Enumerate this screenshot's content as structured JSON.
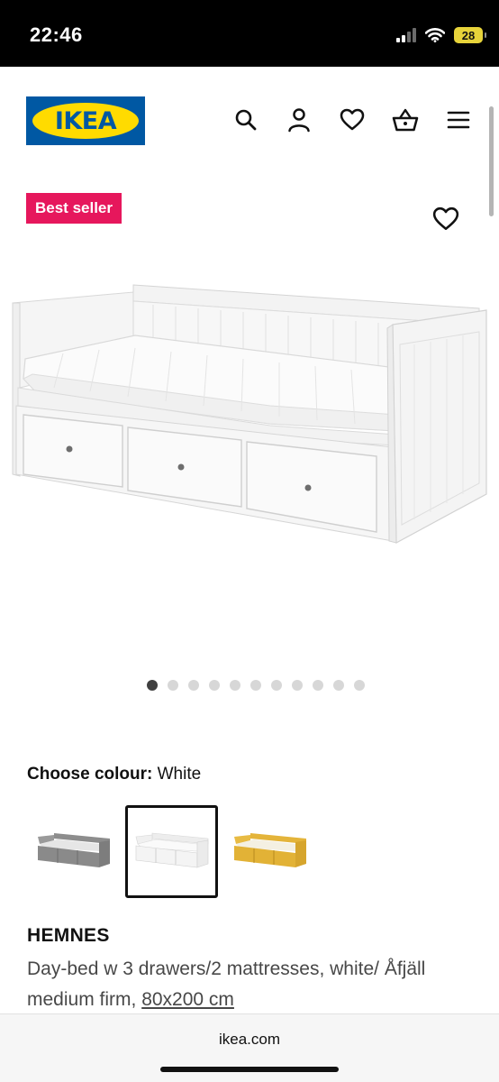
{
  "status_bar": {
    "time": "22:46",
    "battery": "28"
  },
  "header": {
    "logo_text": "IKEA"
  },
  "badge": {
    "label": "Best seller"
  },
  "carousel": {
    "total": 11,
    "active": 1
  },
  "colour": {
    "label": "Choose colour:",
    "value": "White",
    "swatch_colors": [
      "#8a8a8a",
      "#ffffff",
      "#e2b53a"
    ]
  },
  "product": {
    "name": "HEMNES",
    "description": "Day-bed w 3 drawers/2 mattresses, white/ Åfjäll medium firm,",
    "size": "80x200 cm"
  },
  "browser": {
    "url": "ikea.com"
  },
  "colors": {
    "ikea_blue": "#0058a3",
    "ikea_yellow": "#ffdb00",
    "badge_pink": "#e6175c"
  }
}
